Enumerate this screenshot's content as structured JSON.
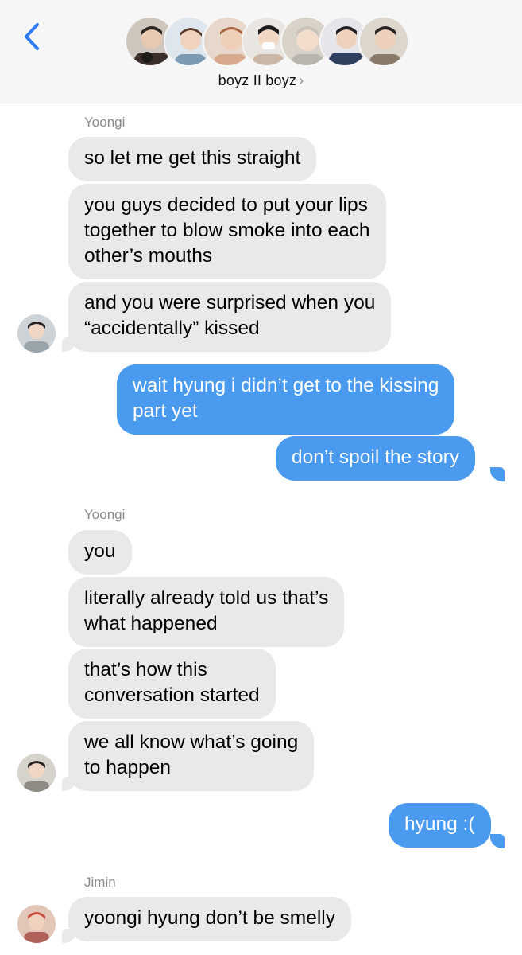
{
  "header": {
    "back_icon": "chevron-left-icon",
    "group_name": "boyz II boyz",
    "chevron": "›",
    "avatar_colors": [
      "#3a2f2a",
      "#7b9bb5",
      "#d9a98e",
      "#cbb7a8",
      "#b8b4ae",
      "#2f3f5e",
      "#8a7a6b"
    ]
  },
  "colors": {
    "incoming": "#e9e9eb",
    "outgoing": "#4a9bf0",
    "accent": "#2f7cf6"
  },
  "messages": [
    {
      "sender_label": "Yoongi"
    },
    {
      "text": "so let me get this straight"
    },
    {
      "text": "you guys decided to put your lips\ntogether to blow smoke into each\nother’s mouths"
    },
    {
      "text": "and you were surprised when you\n“accidentally” kissed"
    },
    {
      "text": "wait hyung i didn’t get to the kissing\npart yet"
    },
    {
      "text": "don’t spoil the story"
    },
    {
      "sender_label": "Yoongi"
    },
    {
      "text": "you"
    },
    {
      "text": "literally already told us that’s\nwhat happened"
    },
    {
      "text": "that’s how this\nconversation started"
    },
    {
      "text": "we all know what’s going\nto happen"
    },
    {
      "text": "hyung :("
    },
    {
      "sender_label": "Jimin"
    },
    {
      "text": "yoongi hyung don’t be smelly"
    }
  ]
}
